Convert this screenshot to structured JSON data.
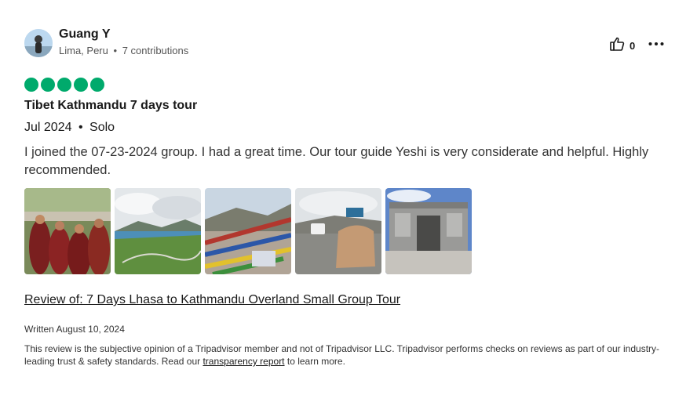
{
  "reviewer": {
    "name": "Guang Y",
    "location": "Lima, Peru",
    "separator": "•",
    "contributions": "7 contributions"
  },
  "helpful": {
    "count": "0",
    "icon": "thumbs-up-icon"
  },
  "more_icon": "more-options-icon",
  "rating": {
    "value": 5,
    "max": 5,
    "color": "#00aa6c"
  },
  "review": {
    "title": "Tibet Kathmandu 7 days tour",
    "date": "Jul 2024",
    "separator": "•",
    "trip_type": "Solo",
    "text": "I joined the 07-23-2024 group. I had a great time. Our tour guide Yeshi is very considerate and helpful. Highly recommended."
  },
  "photos": [
    "monks-photo",
    "lake-valley-photo",
    "prayer-flags-photo",
    "roadside-monument-photo",
    "border-building-photo"
  ],
  "review_of": "Review of: 7 Days Lhasa to Kathmandu Overland Small Group Tour",
  "written": "Written August 10, 2024",
  "disclaimer": {
    "text_before": "This review is the subjective opinion of a Tripadvisor member and not of Tripadvisor LLC. Tripadvisor performs checks on reviews as part of our industry-leading trust & safety standards. Read our ",
    "link": "transparency report",
    "text_after": " to learn more."
  }
}
